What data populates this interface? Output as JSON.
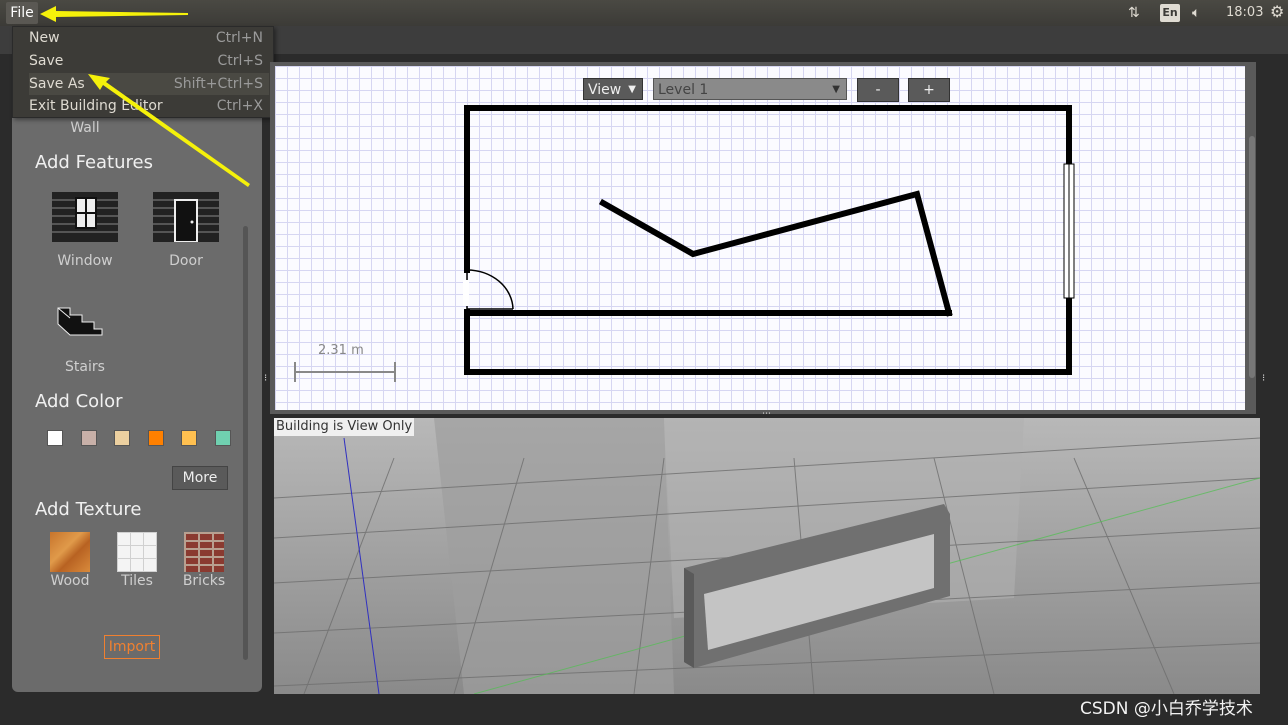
{
  "topbar": {
    "menu_title": "File",
    "keyboard_layout": "En",
    "clock": "18:03"
  },
  "file_menu": {
    "items": [
      {
        "label": "New",
        "shortcut": "Ctrl+N"
      },
      {
        "label": "Save",
        "shortcut": "Ctrl+S"
      },
      {
        "label": "Save As",
        "shortcut": "Shift+Ctrl+S"
      },
      {
        "label": "Exit Building Editor",
        "shortcut": "Ctrl+X"
      }
    ]
  },
  "palette": {
    "wall_label": "Wall",
    "features_heading": "Add Features",
    "features": [
      {
        "label": "Window",
        "icon": "window-icon"
      },
      {
        "label": "Door",
        "icon": "door-icon"
      },
      {
        "label": "Stairs",
        "icon": "stairs-icon"
      }
    ],
    "color_heading": "Add Color",
    "colors": [
      "#ffffff",
      "#c8b0a8",
      "#ecd0a0",
      "#ff8000",
      "#ffc050",
      "#70d0b0"
    ],
    "more_label": "More",
    "texture_heading": "Add Texture",
    "textures": [
      {
        "label": "Wood",
        "icon": "wood-texture-icon"
      },
      {
        "label": "Tiles",
        "icon": "tiles-texture-icon"
      },
      {
        "label": "Bricks",
        "icon": "bricks-texture-icon"
      }
    ],
    "import_label": "Import"
  },
  "editor2d": {
    "view_dropdown": "View",
    "level_dropdown": "Level 1",
    "zoom_out": "-",
    "zoom_in": "+",
    "scale_label": "2.31 m"
  },
  "view3d": {
    "status_label": "Building is View Only"
  },
  "watermark": "CSDN @小白乔学技术"
}
